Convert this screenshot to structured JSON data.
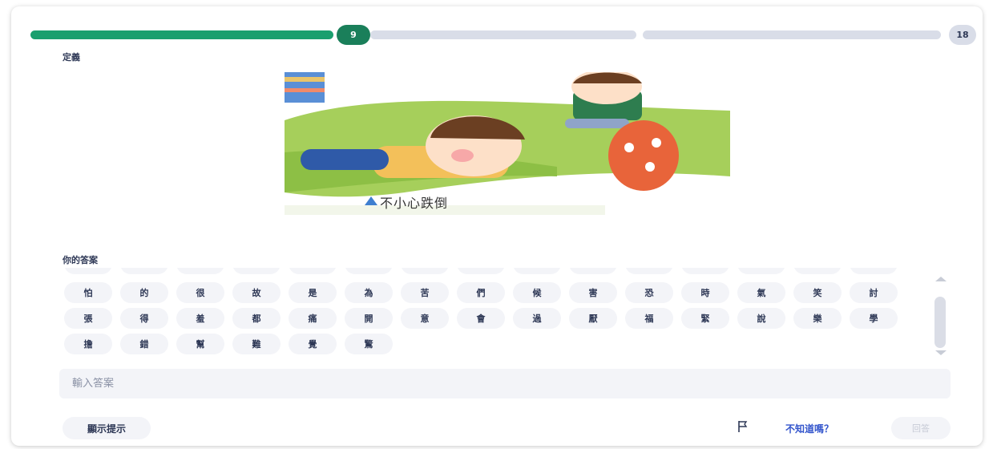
{
  "progress": {
    "current": "9",
    "total": "18",
    "fraction": 0.5
  },
  "question": {
    "definition_label": "定義",
    "image_caption": "不小心跌倒"
  },
  "answer": {
    "label": "你的答案",
    "input_placeholder": "輸入答案",
    "input_value": "",
    "tile_rows": [
      [
        "怕",
        "的",
        "很",
        "故",
        "是",
        "為",
        "苦",
        "們",
        "候",
        "害",
        "恐",
        "時",
        "氣",
        "笑",
        "討"
      ],
      [
        "張",
        "得",
        "羞",
        "都",
        "痛",
        "開",
        "意",
        "會",
        "過",
        "厭",
        "福",
        "緊",
        "說",
        "樂",
        "學"
      ],
      [
        "擔",
        "錯",
        "幫",
        "難",
        "覺",
        "驚"
      ]
    ]
  },
  "footer": {
    "hint_button": "顯示提示",
    "dont_know_link": "不知道嗎？",
    "answer_button": "回答"
  },
  "colors": {
    "progress": "#1a9f6e",
    "badge": "#1a7f5a",
    "link": "#3355cc"
  },
  "icons": {
    "flag": "flag-icon",
    "scroll_up": "chevron-up-icon",
    "scroll_down": "chevron-down-icon"
  }
}
